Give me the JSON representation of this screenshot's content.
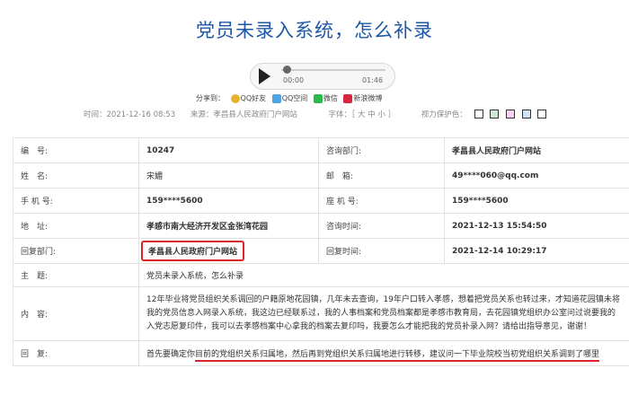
{
  "article": {
    "title": "党员未录入系统，怎么补录"
  },
  "player": {
    "current_time": "00:00",
    "total_time": "01:46",
    "progress": 0
  },
  "share": {
    "label": "分享到：",
    "items": [
      {
        "label": "QQ好友",
        "icon": "qq-icon"
      },
      {
        "label": "QQ空间",
        "icon": "qzone-icon"
      },
      {
        "label": "微信",
        "icon": "wechat-icon"
      },
      {
        "label": "新浪微博",
        "icon": "weibo-icon"
      }
    ]
  },
  "meta": {
    "time": "时间：2021-12-16 08:53",
    "source": "来源：孝昌县人民政府门户网站",
    "font_size": "字体：［ 大 中 小 ］",
    "eye_care": "视力保护色：",
    "eye_colors": [
      "#ffffff",
      "#cfe8d4",
      "#f5d3ee",
      "#cfe3f5",
      "#ffffff"
    ]
  },
  "table": {
    "id_label": "编　号:",
    "id_value": "10247",
    "dept_label": "咨询部门:",
    "dept_value": "孝昌县人民政府门户网站",
    "name_label": "姓　名:",
    "name_value": "宋媚",
    "email_label": "邮　箱:",
    "email_value": "49****060@qq.com",
    "mobile_label": "手 机 号:",
    "mobile_value": "159****5600",
    "phone_label": "座 机 号:",
    "phone_value": "159****5600",
    "address_label": "地　址:",
    "address_value": "孝感市南大经济开发区金张湾花园",
    "ask_time_label": "咨询时间:",
    "ask_time_value": "2021-12-13 15:54:50",
    "reply_dept_label": "回复部门:",
    "reply_dept_value": "孝昌县人民政府门户网站",
    "reply_time_label": "回复时间:",
    "reply_time_value": "2021-12-14 10:29:17",
    "subject_label": "主　题:",
    "subject_value": "党员未录入系统，怎么补录",
    "content_label": "内　容:",
    "content_value": "12年毕业将党员组织关系调回的户籍原地花园镇，几年未去查询，19年户口转入孝感，想着把党员关系也转过来，才知道花园镇未将我的党员信息入网录入系统，我这边已经联系过，我的人事档案和党员档案都是孝感市教育局，去花园镇党组织办公室问过说要我的入党志愿复印件，我可以去孝感档案中心拿我的档案去复印吗，我要怎么才能把我的党员补录入网？请给出指导意见，谢谢！",
    "reply_label": "回　复:",
    "reply_a": "首先要确定你",
    "reply_b": "目前的党组织关系归属地，然后再到党组织关系归属地进行转移，建议问一下毕业院校当初党组织关系调到了哪里"
  }
}
